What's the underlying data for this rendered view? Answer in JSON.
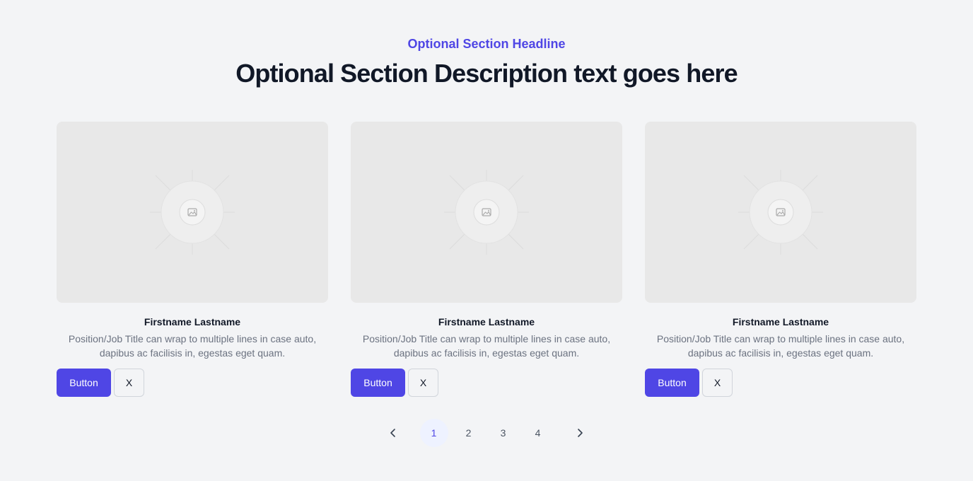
{
  "section": {
    "headline": "Optional Section Headline",
    "description": "Optional Section Description text goes here"
  },
  "cards": [
    {
      "name": "Firstname Lastname",
      "description": "Position/Job Title can wrap to multiple lines in case auto, dapibus ac facilisis in, egestas eget quam.",
      "primary_label": "Button",
      "secondary_label": "X",
      "image_icon": "image-placeholder-icon"
    },
    {
      "name": "Firstname Lastname",
      "description": "Position/Job Title can wrap to multiple lines in case auto, dapibus ac facilisis in, egestas eget quam.",
      "primary_label": "Button",
      "secondary_label": "X",
      "image_icon": "image-placeholder-icon"
    },
    {
      "name": "Firstname Lastname",
      "description": "Position/Job Title can wrap to multiple lines in case auto, dapibus ac facilisis in, egestas eget quam.",
      "primary_label": "Button",
      "secondary_label": "X",
      "image_icon": "image-placeholder-icon"
    }
  ],
  "pagination": {
    "pages": [
      "1",
      "2",
      "3",
      "4"
    ],
    "current": "1",
    "prev_icon": "chevron-left-icon",
    "next_icon": "chevron-right-icon"
  },
  "colors": {
    "accent": "#4f46e5",
    "background": "#f3f4f6",
    "active_page_bg": "#eef2ff"
  }
}
